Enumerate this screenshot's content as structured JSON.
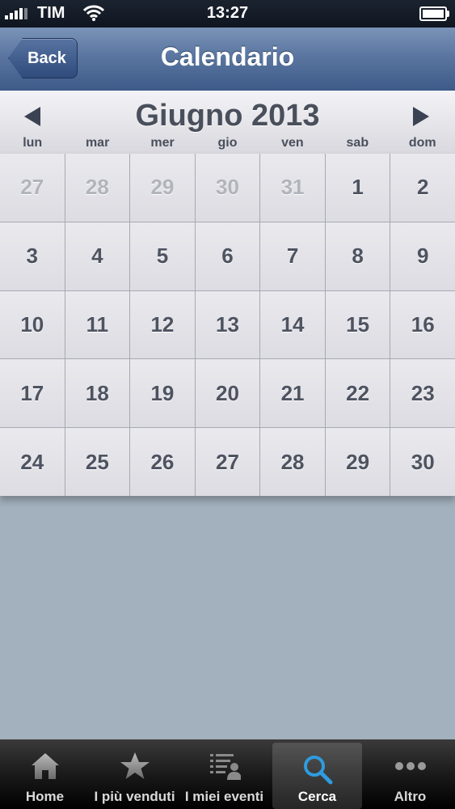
{
  "status_bar": {
    "carrier": "TIM",
    "time": "13:27"
  },
  "nav": {
    "back_label": "Back",
    "title": "Calendario"
  },
  "calendar": {
    "month_title": "Giugno 2013",
    "weekdays": [
      "lun",
      "mar",
      "mer",
      "gio",
      "ven",
      "sab",
      "dom"
    ],
    "days": [
      {
        "n": "27",
        "other": true
      },
      {
        "n": "28",
        "other": true
      },
      {
        "n": "29",
        "other": true
      },
      {
        "n": "30",
        "other": true
      },
      {
        "n": "31",
        "other": true
      },
      {
        "n": "1",
        "other": false
      },
      {
        "n": "2",
        "other": false
      },
      {
        "n": "3",
        "other": false
      },
      {
        "n": "4",
        "other": false
      },
      {
        "n": "5",
        "other": false
      },
      {
        "n": "6",
        "other": false
      },
      {
        "n": "7",
        "other": false
      },
      {
        "n": "8",
        "other": false
      },
      {
        "n": "9",
        "other": false
      },
      {
        "n": "10",
        "other": false
      },
      {
        "n": "11",
        "other": false
      },
      {
        "n": "12",
        "other": false
      },
      {
        "n": "13",
        "other": false
      },
      {
        "n": "14",
        "other": false
      },
      {
        "n": "15",
        "other": false
      },
      {
        "n": "16",
        "other": false
      },
      {
        "n": "17",
        "other": false
      },
      {
        "n": "18",
        "other": false
      },
      {
        "n": "19",
        "other": false
      },
      {
        "n": "20",
        "other": false
      },
      {
        "n": "21",
        "other": false
      },
      {
        "n": "22",
        "other": false
      },
      {
        "n": "23",
        "other": false
      },
      {
        "n": "24",
        "other": false
      },
      {
        "n": "25",
        "other": false
      },
      {
        "n": "26",
        "other": false
      },
      {
        "n": "27",
        "other": false
      },
      {
        "n": "28",
        "other": false
      },
      {
        "n": "29",
        "other": false
      },
      {
        "n": "30",
        "other": false
      }
    ]
  },
  "tabbar": {
    "items": [
      {
        "label": "Home",
        "icon": "home-icon"
      },
      {
        "label": "I più venduti",
        "icon": "star-icon"
      },
      {
        "label": "I miei eventi",
        "icon": "list-person-icon"
      },
      {
        "label": "Cerca",
        "icon": "search-icon",
        "active": true
      },
      {
        "label": "Altro",
        "icon": "more-icon"
      }
    ]
  },
  "colors": {
    "nav_blue": "#3d5a88",
    "active_tab_icon": "#2f9bde"
  }
}
